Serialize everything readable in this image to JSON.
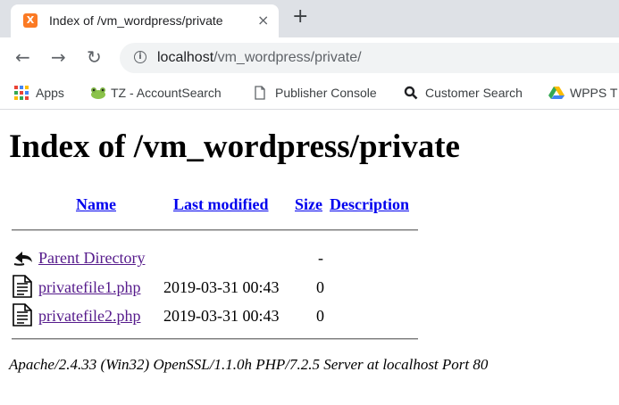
{
  "browser": {
    "tab": {
      "favicon_label": "X",
      "title": "Index of /vm_wordpress/private",
      "close_glyph": "×"
    },
    "new_tab_glyph": "+",
    "toolbar": {
      "back_glyph": "←",
      "forward_glyph": "→",
      "reload_glyph": "↻",
      "url_host": "localhost",
      "url_path": "/vm_wordpress/private/"
    },
    "bookmarks": [
      {
        "label": "Apps",
        "icon": "apps-grid-icon"
      },
      {
        "label": "TZ - AccountSearch",
        "icon": "frog-icon"
      },
      {
        "label": "Publisher Console",
        "icon": "page-icon"
      },
      {
        "label": "Customer Search",
        "icon": "search-icon"
      },
      {
        "label": "WPPS T",
        "icon": "drive-icon"
      }
    ],
    "colors": {
      "tab_strip": "#dee1e6",
      "omnibox": "#f1f3f4",
      "favicon": "#fb7a24",
      "link_visited": "#551a8b",
      "link": "#0000ee"
    }
  },
  "page": {
    "heading": "Index of /vm_wordpress/private",
    "columns": {
      "name": "Name",
      "last_modified": "Last modified",
      "size": "Size",
      "description": "Description"
    },
    "rows": [
      {
        "icon": "back-arrow-icon",
        "name": "Parent Directory",
        "modified": "",
        "size": "-"
      },
      {
        "icon": "file-icon",
        "name": "privatefile1.php",
        "modified": "2019-03-31 00:43",
        "size": "0"
      },
      {
        "icon": "file-icon",
        "name": "privatefile2.php",
        "modified": "2019-03-31 00:43",
        "size": "0"
      }
    ],
    "server_signature": "Apache/2.4.33 (Win32) OpenSSL/1.1.0h PHP/7.2.5 Server at localhost Port 80"
  }
}
